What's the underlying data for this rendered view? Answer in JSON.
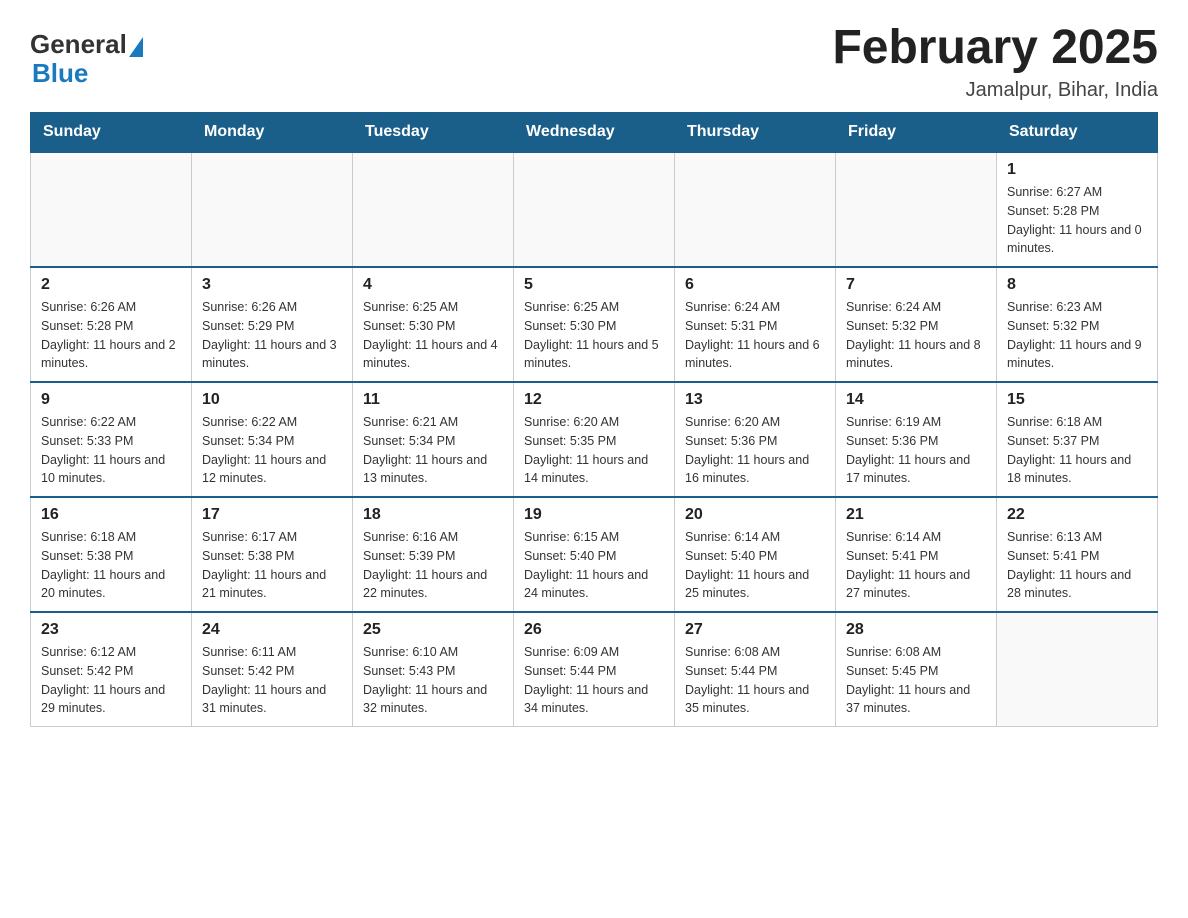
{
  "header": {
    "logo_general": "General",
    "logo_blue": "Blue",
    "month_title": "February 2025",
    "location": "Jamalpur, Bihar, India"
  },
  "weekdays": [
    "Sunday",
    "Monday",
    "Tuesday",
    "Wednesday",
    "Thursday",
    "Friday",
    "Saturday"
  ],
  "weeks": [
    [
      {
        "day": "",
        "info": ""
      },
      {
        "day": "",
        "info": ""
      },
      {
        "day": "",
        "info": ""
      },
      {
        "day": "",
        "info": ""
      },
      {
        "day": "",
        "info": ""
      },
      {
        "day": "",
        "info": ""
      },
      {
        "day": "1",
        "info": "Sunrise: 6:27 AM\nSunset: 5:28 PM\nDaylight: 11 hours and 0 minutes."
      }
    ],
    [
      {
        "day": "2",
        "info": "Sunrise: 6:26 AM\nSunset: 5:28 PM\nDaylight: 11 hours and 2 minutes."
      },
      {
        "day": "3",
        "info": "Sunrise: 6:26 AM\nSunset: 5:29 PM\nDaylight: 11 hours and 3 minutes."
      },
      {
        "day": "4",
        "info": "Sunrise: 6:25 AM\nSunset: 5:30 PM\nDaylight: 11 hours and 4 minutes."
      },
      {
        "day": "5",
        "info": "Sunrise: 6:25 AM\nSunset: 5:30 PM\nDaylight: 11 hours and 5 minutes."
      },
      {
        "day": "6",
        "info": "Sunrise: 6:24 AM\nSunset: 5:31 PM\nDaylight: 11 hours and 6 minutes."
      },
      {
        "day": "7",
        "info": "Sunrise: 6:24 AM\nSunset: 5:32 PM\nDaylight: 11 hours and 8 minutes."
      },
      {
        "day": "8",
        "info": "Sunrise: 6:23 AM\nSunset: 5:32 PM\nDaylight: 11 hours and 9 minutes."
      }
    ],
    [
      {
        "day": "9",
        "info": "Sunrise: 6:22 AM\nSunset: 5:33 PM\nDaylight: 11 hours and 10 minutes."
      },
      {
        "day": "10",
        "info": "Sunrise: 6:22 AM\nSunset: 5:34 PM\nDaylight: 11 hours and 12 minutes."
      },
      {
        "day": "11",
        "info": "Sunrise: 6:21 AM\nSunset: 5:34 PM\nDaylight: 11 hours and 13 minutes."
      },
      {
        "day": "12",
        "info": "Sunrise: 6:20 AM\nSunset: 5:35 PM\nDaylight: 11 hours and 14 minutes."
      },
      {
        "day": "13",
        "info": "Sunrise: 6:20 AM\nSunset: 5:36 PM\nDaylight: 11 hours and 16 minutes."
      },
      {
        "day": "14",
        "info": "Sunrise: 6:19 AM\nSunset: 5:36 PM\nDaylight: 11 hours and 17 minutes."
      },
      {
        "day": "15",
        "info": "Sunrise: 6:18 AM\nSunset: 5:37 PM\nDaylight: 11 hours and 18 minutes."
      }
    ],
    [
      {
        "day": "16",
        "info": "Sunrise: 6:18 AM\nSunset: 5:38 PM\nDaylight: 11 hours and 20 minutes."
      },
      {
        "day": "17",
        "info": "Sunrise: 6:17 AM\nSunset: 5:38 PM\nDaylight: 11 hours and 21 minutes."
      },
      {
        "day": "18",
        "info": "Sunrise: 6:16 AM\nSunset: 5:39 PM\nDaylight: 11 hours and 22 minutes."
      },
      {
        "day": "19",
        "info": "Sunrise: 6:15 AM\nSunset: 5:40 PM\nDaylight: 11 hours and 24 minutes."
      },
      {
        "day": "20",
        "info": "Sunrise: 6:14 AM\nSunset: 5:40 PM\nDaylight: 11 hours and 25 minutes."
      },
      {
        "day": "21",
        "info": "Sunrise: 6:14 AM\nSunset: 5:41 PM\nDaylight: 11 hours and 27 minutes."
      },
      {
        "day": "22",
        "info": "Sunrise: 6:13 AM\nSunset: 5:41 PM\nDaylight: 11 hours and 28 minutes."
      }
    ],
    [
      {
        "day": "23",
        "info": "Sunrise: 6:12 AM\nSunset: 5:42 PM\nDaylight: 11 hours and 29 minutes."
      },
      {
        "day": "24",
        "info": "Sunrise: 6:11 AM\nSunset: 5:42 PM\nDaylight: 11 hours and 31 minutes."
      },
      {
        "day": "25",
        "info": "Sunrise: 6:10 AM\nSunset: 5:43 PM\nDaylight: 11 hours and 32 minutes."
      },
      {
        "day": "26",
        "info": "Sunrise: 6:09 AM\nSunset: 5:44 PM\nDaylight: 11 hours and 34 minutes."
      },
      {
        "day": "27",
        "info": "Sunrise: 6:08 AM\nSunset: 5:44 PM\nDaylight: 11 hours and 35 minutes."
      },
      {
        "day": "28",
        "info": "Sunrise: 6:08 AM\nSunset: 5:45 PM\nDaylight: 11 hours and 37 minutes."
      },
      {
        "day": "",
        "info": ""
      }
    ]
  ]
}
